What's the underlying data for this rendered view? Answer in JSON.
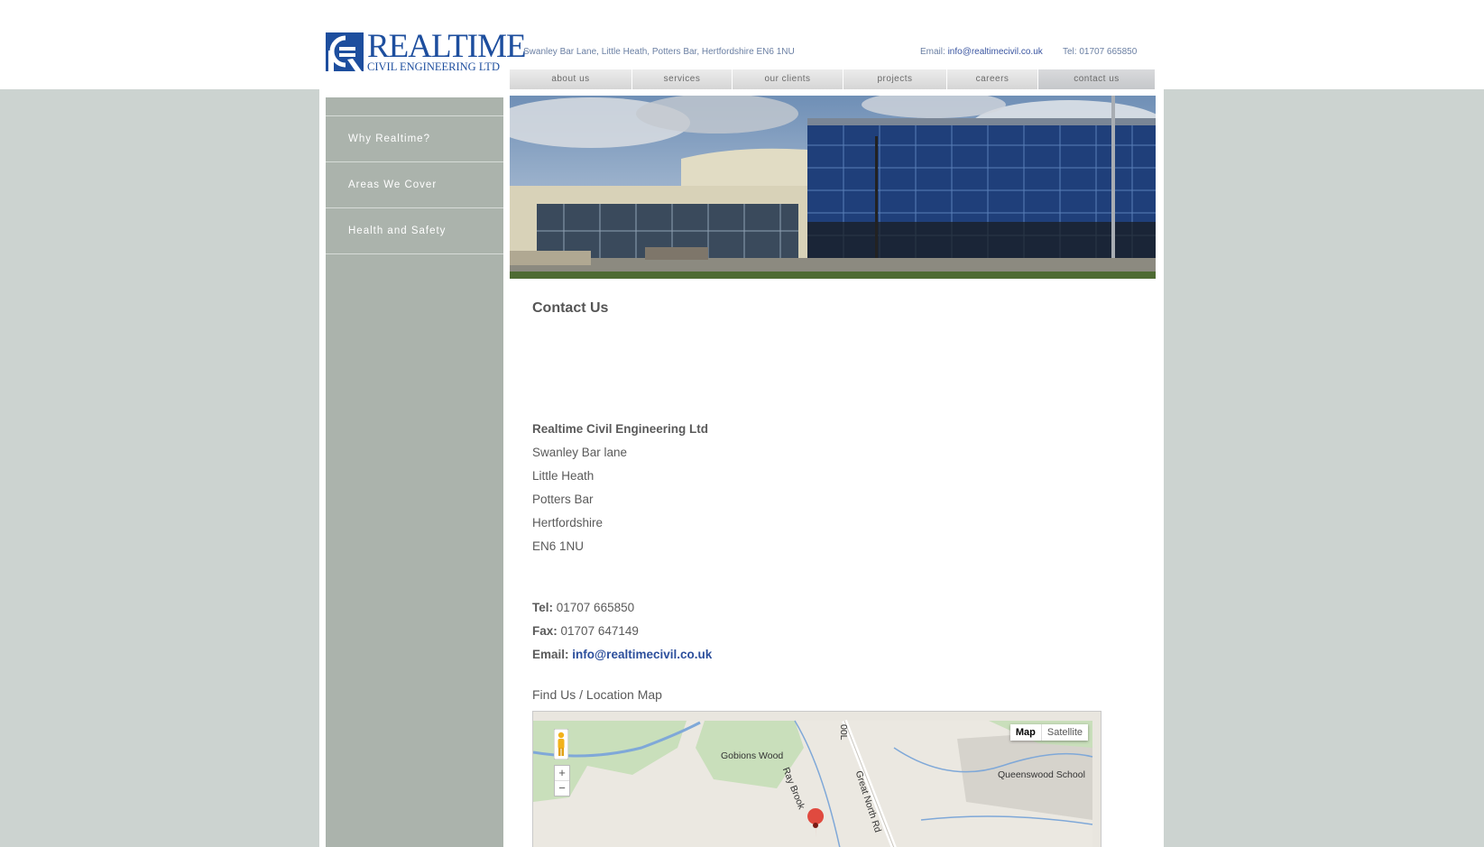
{
  "header": {
    "logo_word": "REALTIME",
    "logo_sub": "CIVIL ENGINEERING LTD",
    "address": "Swanley Bar Lane, Little Heath, Potters Bar, Hertfordshire EN6 1NU",
    "email_label": "Email:",
    "email": "info@realtimecivil.co.uk",
    "tel": "Tel: 01707 665850"
  },
  "nav": {
    "tabs": [
      {
        "label": "about us"
      },
      {
        "label": "services"
      },
      {
        "label": "our clients"
      },
      {
        "label": "projects"
      },
      {
        "label": "careers"
      },
      {
        "label": "contact us"
      }
    ],
    "active": "contact us"
  },
  "sidebar": {
    "items": [
      {
        "label": "Why Realtime?"
      },
      {
        "label": "Areas We Cover"
      },
      {
        "label": "Health and Safety"
      }
    ]
  },
  "content": {
    "title": "Contact Us",
    "company": "Realtime Civil Engineering Ltd",
    "address_lines": [
      "Swanley Bar lane",
      "Little Heath",
      "Potters Bar",
      "Hertfordshire",
      "EN6 1NU"
    ],
    "tel_label": "Tel:",
    "tel_value": "01707 665850",
    "fax_label": "Fax:",
    "fax_value": "01707 647149",
    "email_label": "Email:",
    "email_value": "info@realtimecivil.co.uk",
    "map_heading": "Find Us / Location Map"
  },
  "map": {
    "type_map": "Map",
    "type_satellite": "Satellite",
    "zoom_in": "+",
    "zoom_out": "−",
    "labels": {
      "wood": "Gobions Wood",
      "brook": "Ray Brook",
      "road": "Great North Rd",
      "road_code": "00L",
      "school": "Queenswood School"
    }
  },
  "colors": {
    "brand_blue": "#1d4e9e",
    "link_blue": "#2c4f9c",
    "background": "#ccd3d0",
    "sidebar": "#abb3ac"
  }
}
